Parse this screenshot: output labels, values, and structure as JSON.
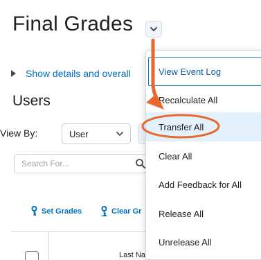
{
  "page": {
    "title": "Final Grades"
  },
  "details": {
    "show_label": "Show details and overall"
  },
  "users_section": {
    "title": "Users",
    "view_by_label": "View By:",
    "view_by_value": "User",
    "search_placeholder": "Search For..."
  },
  "actions": {
    "set_grades": "Set Grades",
    "clear_grades": "Clear Gr"
  },
  "table": {
    "header_name": "Last Name ▲ , First Name"
  },
  "menu": {
    "items": [
      "View Event Log",
      "Recalculate All",
      "Transfer All",
      "Clear All",
      "Add Feedback for All",
      "Release All",
      "Unrelease All"
    ]
  },
  "colors": {
    "link": "#006fbf",
    "annotation": "#e8692f",
    "menu_highlight": "#e3f1fc"
  },
  "icons": {
    "title_dropdown": "chevron-down-icon",
    "details_toggle": "triangle-right-icon",
    "search": "magnifier-icon",
    "set_grades": "key-icon",
    "clear_grades": "key-icon"
  }
}
